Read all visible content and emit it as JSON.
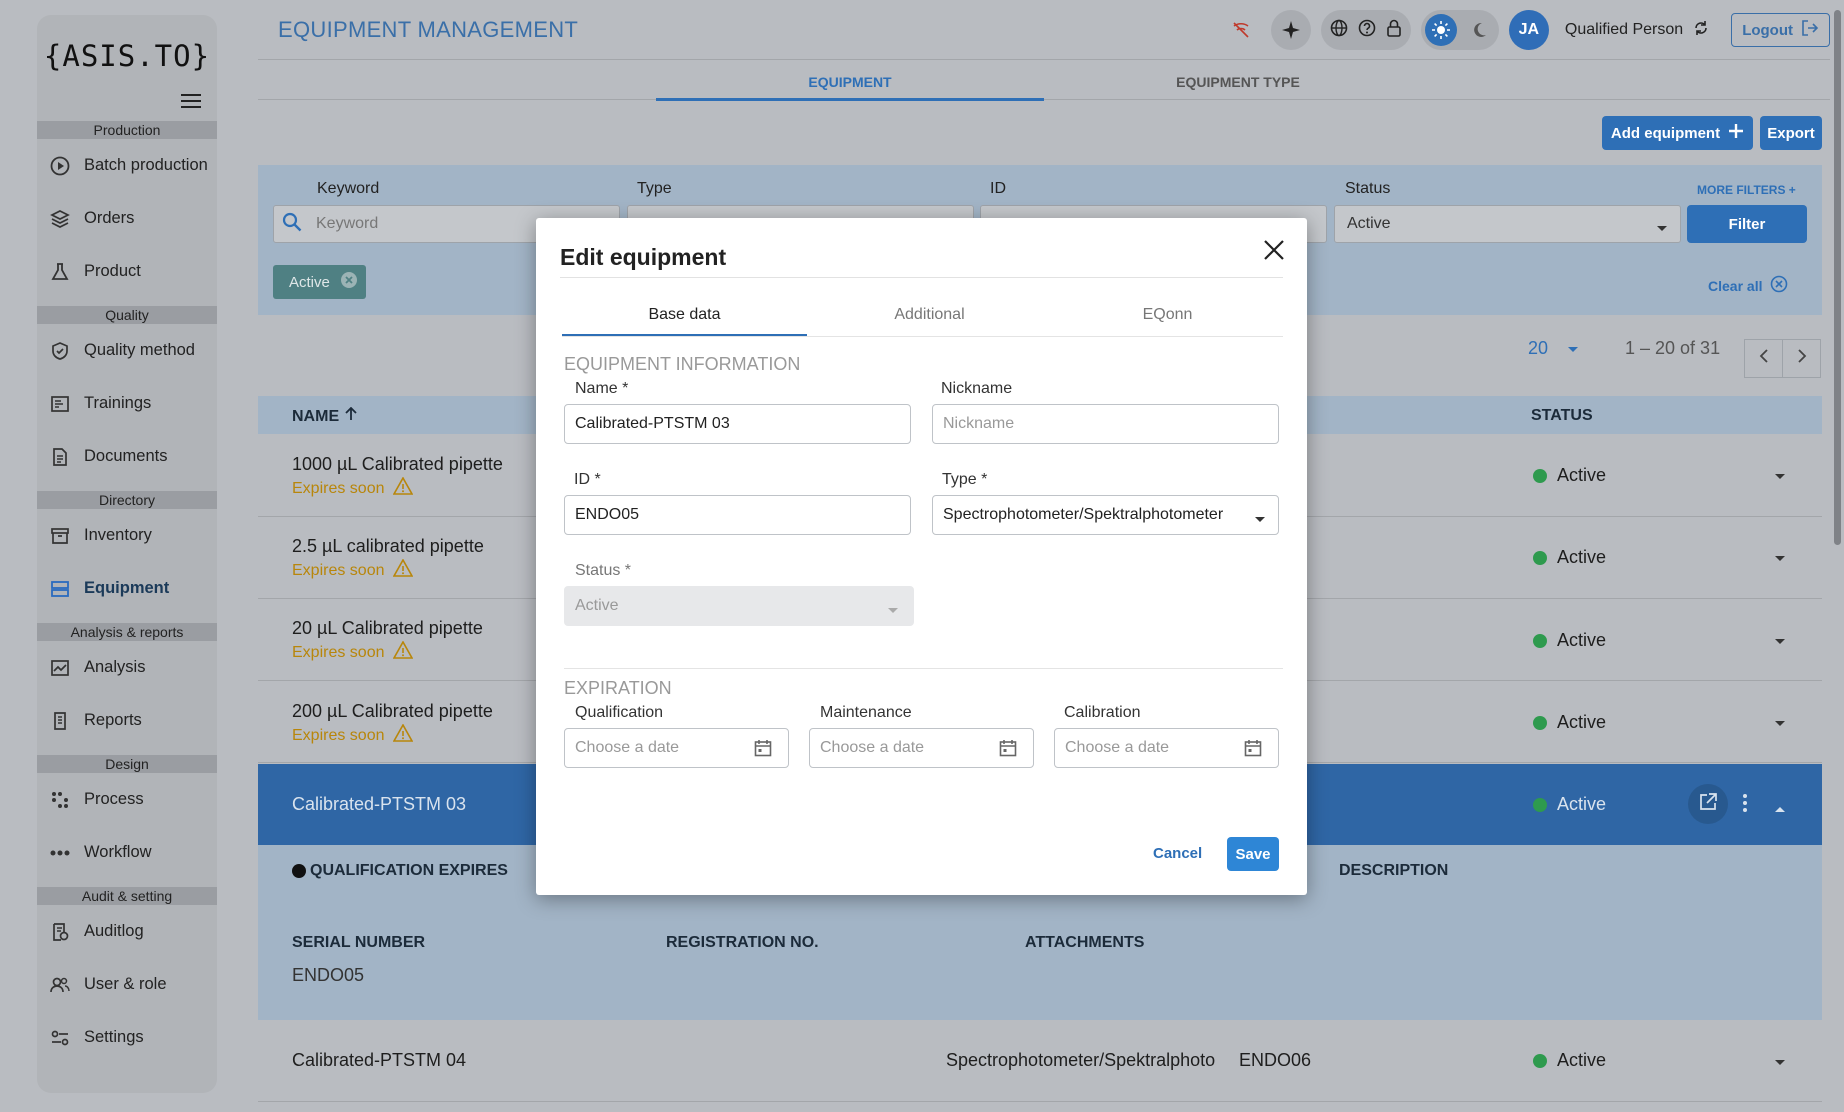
{
  "app": {
    "logo": "{ASIS.TO}"
  },
  "sidebar": {
    "sections": [
      {
        "title": "Production",
        "items": [
          {
            "label": "Batch production",
            "icon": "play-circle-icon"
          },
          {
            "label": "Orders",
            "icon": "layers-icon"
          },
          {
            "label": "Product",
            "icon": "flask-icon"
          }
        ]
      },
      {
        "title": "Quality",
        "items": [
          {
            "label": "Quality method",
            "icon": "shield-check-icon"
          },
          {
            "label": "Trainings",
            "icon": "training-icon"
          },
          {
            "label": "Documents",
            "icon": "document-icon"
          }
        ]
      },
      {
        "title": "Directory",
        "items": [
          {
            "label": "Inventory",
            "icon": "archive-icon"
          },
          {
            "label": "Equipment",
            "icon": "equipment-icon"
          }
        ]
      },
      {
        "title": "Analysis & reports",
        "items": [
          {
            "label": "Analysis",
            "icon": "analysis-chart-icon"
          },
          {
            "label": "Reports",
            "icon": "report-icon"
          }
        ]
      },
      {
        "title": "Design",
        "items": [
          {
            "label": "Process",
            "icon": "process-icon"
          },
          {
            "label": "Workflow",
            "icon": "workflow-icon"
          }
        ]
      },
      {
        "title": "Audit & setting",
        "items": [
          {
            "label": "Auditlog",
            "icon": "auditlog-icon"
          },
          {
            "label": "User & role",
            "icon": "users-icon"
          },
          {
            "label": "Settings",
            "icon": "settings-sliders-icon"
          }
        ]
      }
    ],
    "active": "Equipment"
  },
  "header": {
    "title": "EQUIPMENT MANAGEMENT",
    "user_initials": "JA",
    "user_name": "Qualified Person",
    "logout_label": "Logout"
  },
  "tabs": {
    "equipment": "EQUIPMENT",
    "equipment_type": "EQUIPMENT TYPE"
  },
  "toolbar": {
    "add_label": "Add equipment",
    "export_label": "Export"
  },
  "filters": {
    "keyword_label": "Keyword",
    "keyword_placeholder": "Keyword",
    "type_label": "Type",
    "id_label": "ID",
    "status_label": "Status",
    "status_value": "Active",
    "more_filters": "MORE FILTERS +",
    "filter_button": "Filter",
    "chip": "Active",
    "clear_all": "Clear all"
  },
  "pagination": {
    "page_size": "20",
    "range": "1 – 20 of 31"
  },
  "table": {
    "col_name": "NAME",
    "col_status": "STATUS",
    "rows": [
      {
        "name": "1000 µL Calibrated pipette",
        "warning": "Expires soon",
        "status": "Active"
      },
      {
        "name": "2.5 µL calibrated pipette",
        "warning": "Expires soon",
        "status": "Active"
      },
      {
        "name": "20 µL Calibrated pipette",
        "warning": "Expires soon",
        "status": "Active"
      },
      {
        "name": "200 µL Calibrated pipette",
        "warning": "Expires soon",
        "status": "Active"
      }
    ],
    "selected": {
      "name": "Calibrated-PTSTM 03",
      "status": "Active"
    },
    "detail": {
      "qualification_expires": "QUALIFICATION EXPIRES",
      "description": "DESCRIPTION",
      "serial_number_label": "SERIAL NUMBER",
      "serial_number_value": "ENDO05",
      "registration_label": "REGISTRATION NO.",
      "attachments_label": "ATTACHMENTS"
    },
    "last_row": {
      "name": "Calibrated-PTSTM 04",
      "type": "Spectrophotometer/Spektralphoto",
      "id": "ENDO06",
      "status": "Active"
    }
  },
  "modal": {
    "title": "Edit equipment",
    "tabs": [
      "Base data",
      "Additional",
      "EQonn"
    ],
    "section_info": "EQUIPMENT INFORMATION",
    "name_label": "Name *",
    "name_value": "Calibrated-PTSTM 03",
    "nickname_label": "Nickname",
    "nickname_placeholder": "Nickname",
    "id_label": "ID *",
    "id_value": "ENDO05",
    "type_label": "Type *",
    "type_value": "Spectrophotometer/Spektralphotometer",
    "status_label": "Status *",
    "status_value": "Active",
    "section_expiration": "EXPIRATION",
    "qualification_label": "Qualification",
    "maintenance_label": "Maintenance",
    "calibration_label": "Calibration",
    "date_placeholder": "Choose a date",
    "cancel_label": "Cancel",
    "save_label": "Save"
  }
}
